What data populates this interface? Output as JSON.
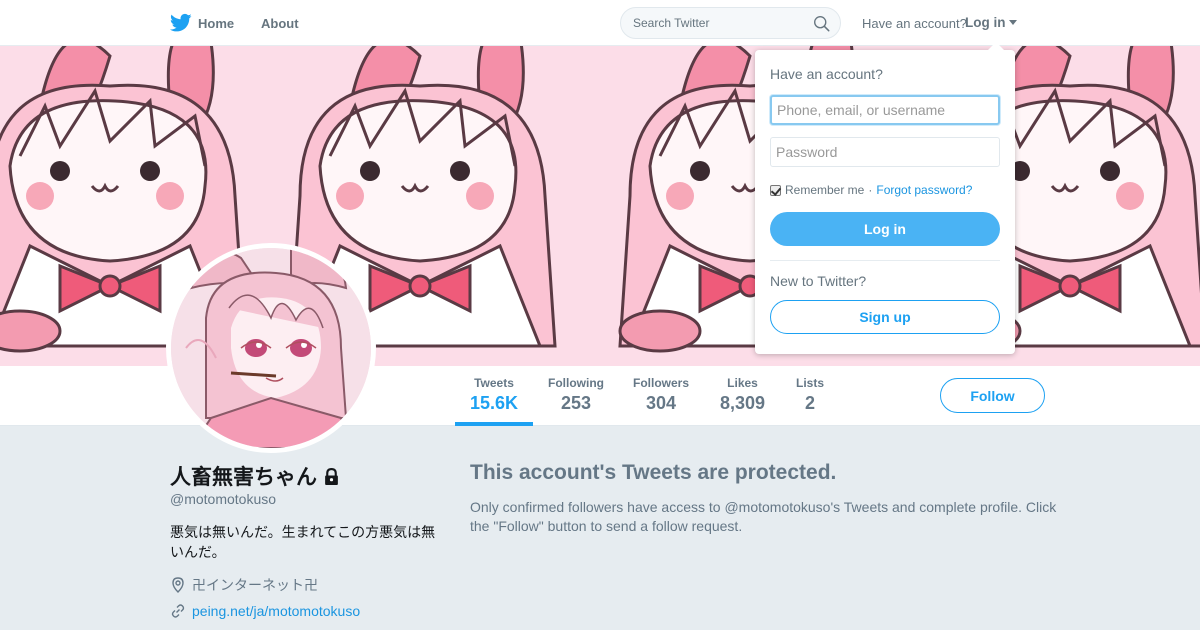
{
  "colors": {
    "twitter_blue": "#1da1f2",
    "link": "#1b95e0",
    "muted": "#657786",
    "background": "#e6ecf0"
  },
  "topnav": {
    "home_label": "Home",
    "about_label": "About",
    "search_placeholder": "Search Twitter",
    "have_account": "Have an account?",
    "login_label": "Log in"
  },
  "profile": {
    "name": "人畜無害ちゃん",
    "handle": "@motomotokuso",
    "bio": "悪気は無いんだ。生まれてこの方悪気は無いんだ。",
    "location": "卍インターネット卍",
    "url": "peing.net/ja/motomotokuso",
    "protected": true
  },
  "stats": [
    {
      "label": "Tweets",
      "value": "15.6K",
      "active": true
    },
    {
      "label": "Following",
      "value": "253",
      "active": false
    },
    {
      "label": "Followers",
      "value": "304",
      "active": false
    },
    {
      "label": "Likes",
      "value": "8,309",
      "active": false
    },
    {
      "label": "Lists",
      "value": "2",
      "active": false
    }
  ],
  "follow_label": "Follow",
  "protected_notice": {
    "title": "This account's Tweets are protected.",
    "text": "Only confirmed followers have access to @motomotokuso's Tweets and complete profile. Click the \"Follow\" button to send a follow request."
  },
  "login_dropdown": {
    "title": "Have an account?",
    "username_placeholder": "Phone, email, or username",
    "password_placeholder": "Password",
    "remember_label": "Remember me",
    "separator": "·",
    "forgot_label": "Forgot password?",
    "login_button": "Log in",
    "new_prompt": "New to Twitter?",
    "signup_button": "Sign up"
  },
  "icons": [
    "twitter-bird-icon",
    "search-icon",
    "caret-down-icon",
    "lock-icon",
    "location-pin-icon",
    "link-icon"
  ]
}
